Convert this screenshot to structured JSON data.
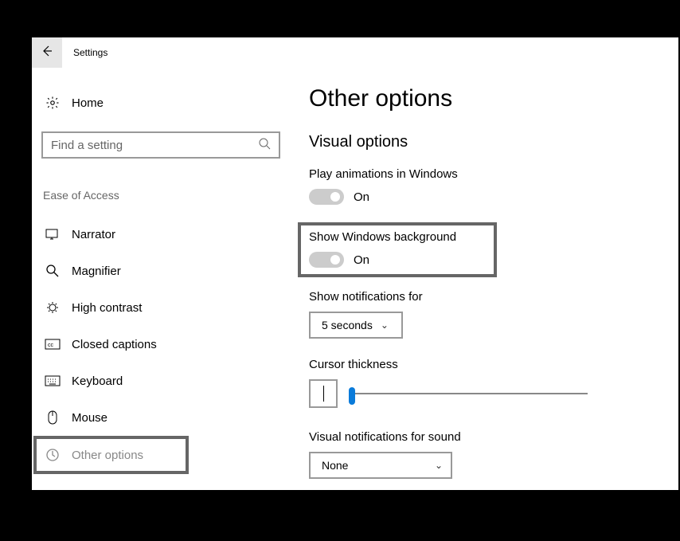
{
  "titlebar": {
    "title": "Settings"
  },
  "sidebar": {
    "home_label": "Home",
    "search_placeholder": "Find a setting",
    "category_label": "Ease of Access",
    "items": [
      {
        "label": "Narrator"
      },
      {
        "label": "Magnifier"
      },
      {
        "label": "High contrast"
      },
      {
        "label": "Closed captions"
      },
      {
        "label": "Keyboard"
      },
      {
        "label": "Mouse"
      },
      {
        "label": "Other options"
      }
    ]
  },
  "main": {
    "title": "Other options",
    "section_title": "Visual options",
    "play_animations": {
      "label": "Play animations in Windows",
      "state": "On"
    },
    "show_background": {
      "label": "Show Windows background",
      "state": "On"
    },
    "notifications": {
      "label": "Show notifications for",
      "value": "5 seconds"
    },
    "cursor": {
      "label": "Cursor thickness"
    },
    "visual_notifications": {
      "label": "Visual notifications for sound",
      "value": "None"
    }
  }
}
